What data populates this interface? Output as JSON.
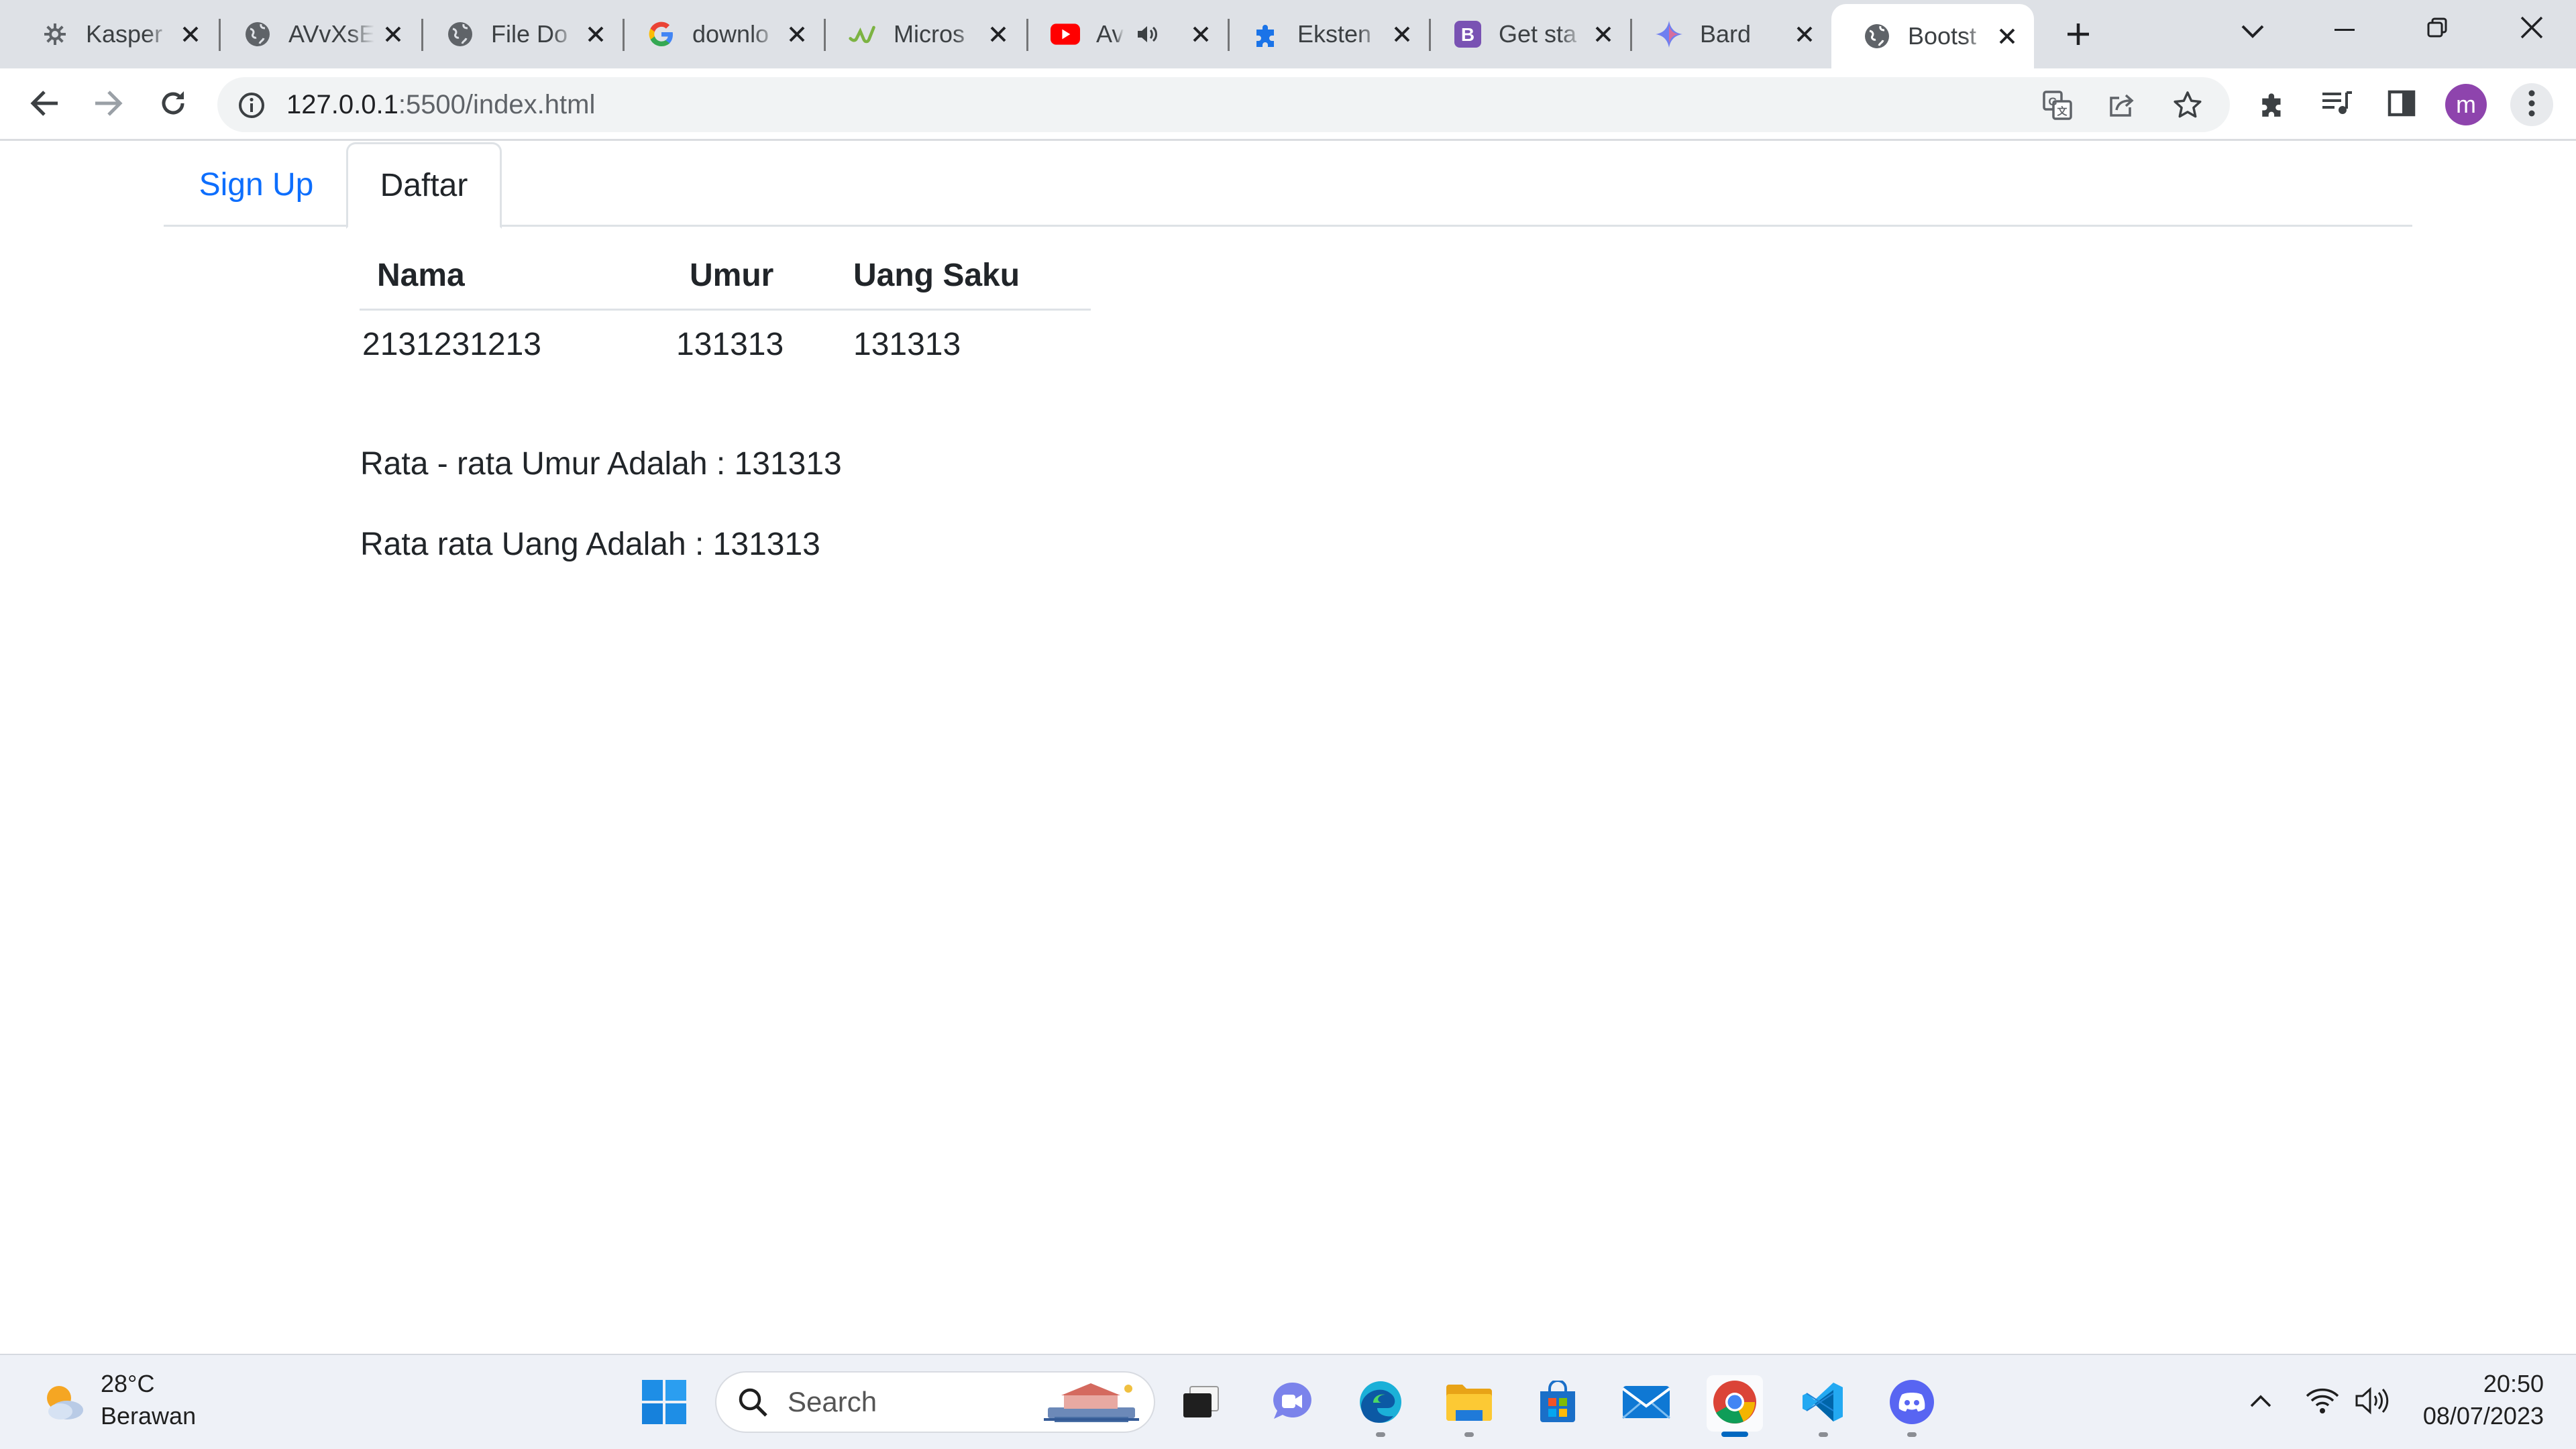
{
  "browser": {
    "tabs": [
      {
        "title": "Kasper",
        "icon": "kaspersky-icon"
      },
      {
        "title": "AVvXsE",
        "icon": "globe-icon"
      },
      {
        "title": "File Do",
        "icon": "globe-icon"
      },
      {
        "title": "downlo",
        "icon": "google-icon"
      },
      {
        "title": "Micros",
        "icon": "learn-icon"
      },
      {
        "title": "Av",
        "icon": "youtube-icon"
      },
      {
        "title": "Eksten",
        "icon": "extension-icon"
      },
      {
        "title": "Get sta",
        "icon": "bootstrap-icon"
      },
      {
        "title": "Bard",
        "icon": "bard-icon"
      },
      {
        "title": "Bootst",
        "icon": "globe-icon"
      }
    ],
    "url_host": "127.0.0.1",
    "url_rest": ":5500/index.html",
    "profile_initial": "m"
  },
  "page": {
    "nav_tabs": [
      "Sign Up",
      "Daftar"
    ],
    "table": {
      "headers": [
        "Nama",
        "Umur",
        "Uang Saku"
      ],
      "rows": [
        [
          "2131231213",
          "131313",
          "131313"
        ]
      ]
    },
    "avg_umur": "Rata - rata Umur Adalah : 131313",
    "avg_uang": "Rata rata Uang Adalah : 131313"
  },
  "taskbar": {
    "weather_temp": "28°C",
    "weather_desc": "Berawan",
    "search_label": "Search",
    "time": "20:50",
    "date": "08/07/2023"
  },
  "colors": {
    "link": "#0d6efd",
    "tab_strip": "#dee1e6",
    "profile": "#8e44ad"
  }
}
